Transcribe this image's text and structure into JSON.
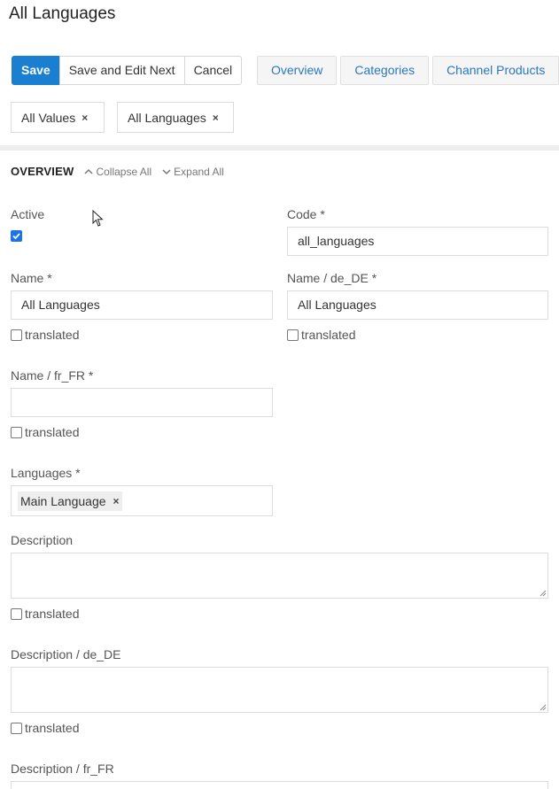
{
  "page": {
    "title": "All Languages"
  },
  "toolbar": {
    "save_label": "Save",
    "save_edit_next_label": "Save and Edit Next",
    "cancel_label": "Cancel"
  },
  "tabs": [
    {
      "label": "Overview"
    },
    {
      "label": "Categories"
    },
    {
      "label": "Channel Products"
    }
  ],
  "filters": {
    "values_tag": "All Values",
    "languages_tag": "All Languages"
  },
  "section": {
    "title": "OVERVIEW",
    "collapse_all": "Collapse All",
    "expand_all": "Expand All"
  },
  "fields": {
    "active": {
      "label": "Active",
      "checked": true
    },
    "code": {
      "label": "Code *",
      "value": "all_languages"
    },
    "name": {
      "label": "Name *",
      "value": "All Languages",
      "translated_label": "translated"
    },
    "name_de": {
      "label": "Name / de_DE *",
      "value": "All Languages",
      "translated_label": "translated"
    },
    "name_fr": {
      "label": "Name / fr_FR *",
      "value": "",
      "translated_label": "translated"
    },
    "languages": {
      "label": "Languages *",
      "tags": [
        "Main Language"
      ]
    },
    "description": {
      "label": "Description",
      "value": "",
      "translated_label": "translated"
    },
    "description_de": {
      "label": "Description / de_DE",
      "value": "",
      "translated_label": "translated"
    },
    "description_fr": {
      "label": "Description / fr_FR",
      "value": ""
    }
  },
  "icons": {
    "remove": "close-icon",
    "collapse": "chevron-up-icon",
    "expand": "chevron-down-icon",
    "checkbox": "checkbox-icon",
    "cursor": "mouse-pointer-icon"
  },
  "colors": {
    "primary": "#1a7fd1",
    "link": "#2a77c0",
    "checkbox_checked": "#1a73e8"
  }
}
